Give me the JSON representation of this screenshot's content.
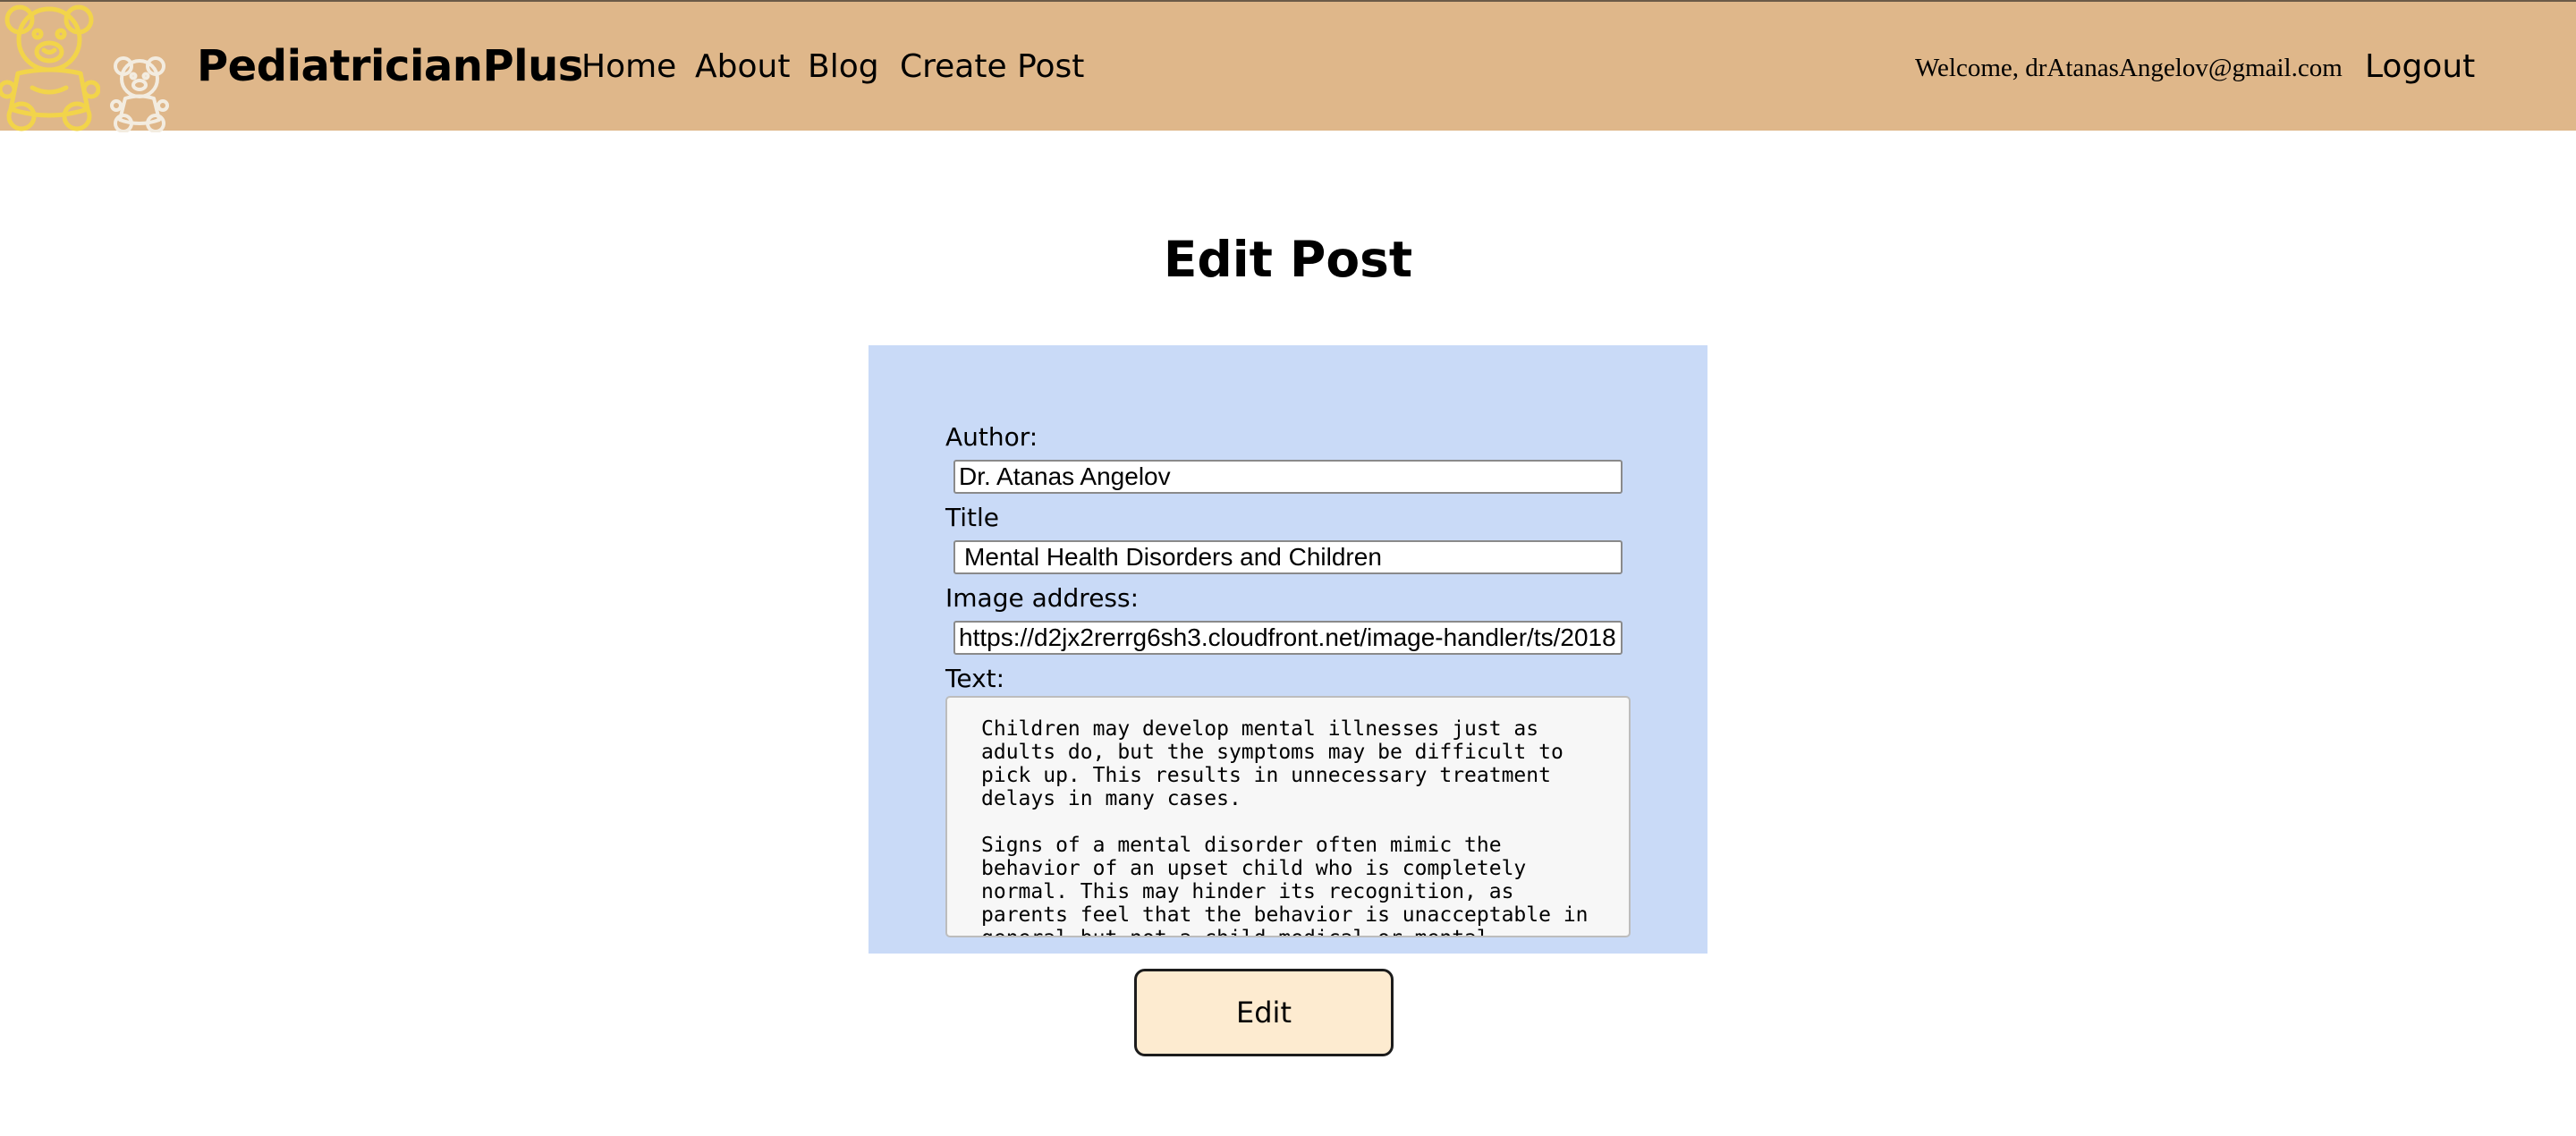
{
  "header": {
    "brand": "PediatricianPlus",
    "nav": [
      "Home",
      "About",
      "Blog",
      "Create Post"
    ],
    "welcome": "Welcome, drAtanasAngelov@gmail.com",
    "logout": "Logout",
    "colors": {
      "background": "#dfb78a",
      "logo_bear_primary": "#f2d44a",
      "logo_bear_secondary": "#f3ece0"
    },
    "icons": [
      "teddy-bear-logo-icon",
      "teddy-bear-small-icon"
    ]
  },
  "page": {
    "title": "Edit Post"
  },
  "form": {
    "author_label": "Author:",
    "author_value": "Dr. Atanas Angelov",
    "title_label": "Title",
    "title_value": "Mental Health Disorders and Children",
    "image_label": "Image address:",
    "image_value": "https://d2jx2rerrg6sh3.cloudfront.net/image-handler/ts/2018",
    "text_label": "Text:",
    "text_value": "Children may develop mental illnesses just as adults do, but the symptoms may be difficult to pick up. This results in unnecessary treatment delays in many cases.\n\nSigns of a mental disorder often mimic the behavior of an upset child who is completely normal. This may hinder its recognition, as parents feel that the behavior is unacceptable in general but not a child medical or mental behavior.",
    "submit_label": "Edit",
    "colors": {
      "form_background": "#c9daf7",
      "button_background": "#fdebd0"
    }
  }
}
